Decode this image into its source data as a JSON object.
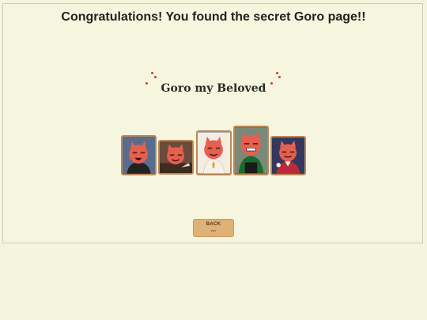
{
  "header": {
    "title": "Congratulations! You found the secret Goro page!!"
  },
  "gallery": {
    "title": "Goro my Beloved",
    "cards": [
      {
        "name": "goro-card-1",
        "bg": "#5a6c8d",
        "shirt": "#222222"
      },
      {
        "name": "goro-card-2",
        "bg": "#6b4b3b",
        "shirt": "#2a2a2a"
      },
      {
        "name": "goro-card-3",
        "bg": "#f3ece0",
        "shirt": "#f4f2e8"
      },
      {
        "name": "goro-card-4",
        "bg": "#7a8a7a",
        "shirt": "#1d6b2c"
      },
      {
        "name": "goro-card-5",
        "bg": "#33385c",
        "shirt": "#b92a3a"
      }
    ]
  },
  "back_button": {
    "label": "BACK",
    "sublabel": "esc"
  },
  "colors": {
    "background": "#f5f4dc",
    "button": "#deb276",
    "accent": "#d8363a"
  }
}
